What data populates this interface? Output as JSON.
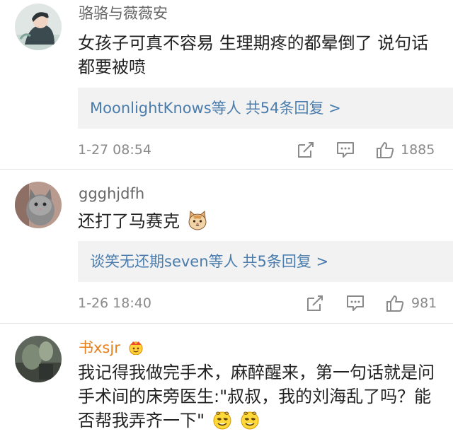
{
  "comments": [
    {
      "username": "骆骆与薇薇安",
      "content": "女孩子可真不容易 生理期疼的都晕倒了 说句话都要被喷",
      "replies": {
        "who": "MoonlightKnows等人",
        "count": "共54条回复 >"
      },
      "time": "1-27 08:54",
      "likes": "1885"
    },
    {
      "username": "ggghjdfh",
      "content": "还打了马赛克",
      "emoji": "cat-face-emoji",
      "replies": {
        "who": "谈笑无还期seven等人",
        "count": "共5条回复 >"
      },
      "time": "1-26 18:40",
      "likes": "981"
    },
    {
      "username": "书xsjr",
      "badge": "crown-badge-icon",
      "content": "我记得我做完手术，麻醉醒来，第一句话就是问手术间的床旁医生:\"叔叔，我的刘海乱了吗？能否帮我弄齐一下\"",
      "emoji": "dizzy-face-emoji"
    }
  ],
  "colors": {
    "link": "#4a7dad",
    "vip_name": "#e8801a",
    "reply_bg": "#f2f2f2",
    "meta": "#8a8a8a"
  },
  "icons": [
    "share-icon",
    "comment-icon",
    "thumbs-up-icon"
  ]
}
